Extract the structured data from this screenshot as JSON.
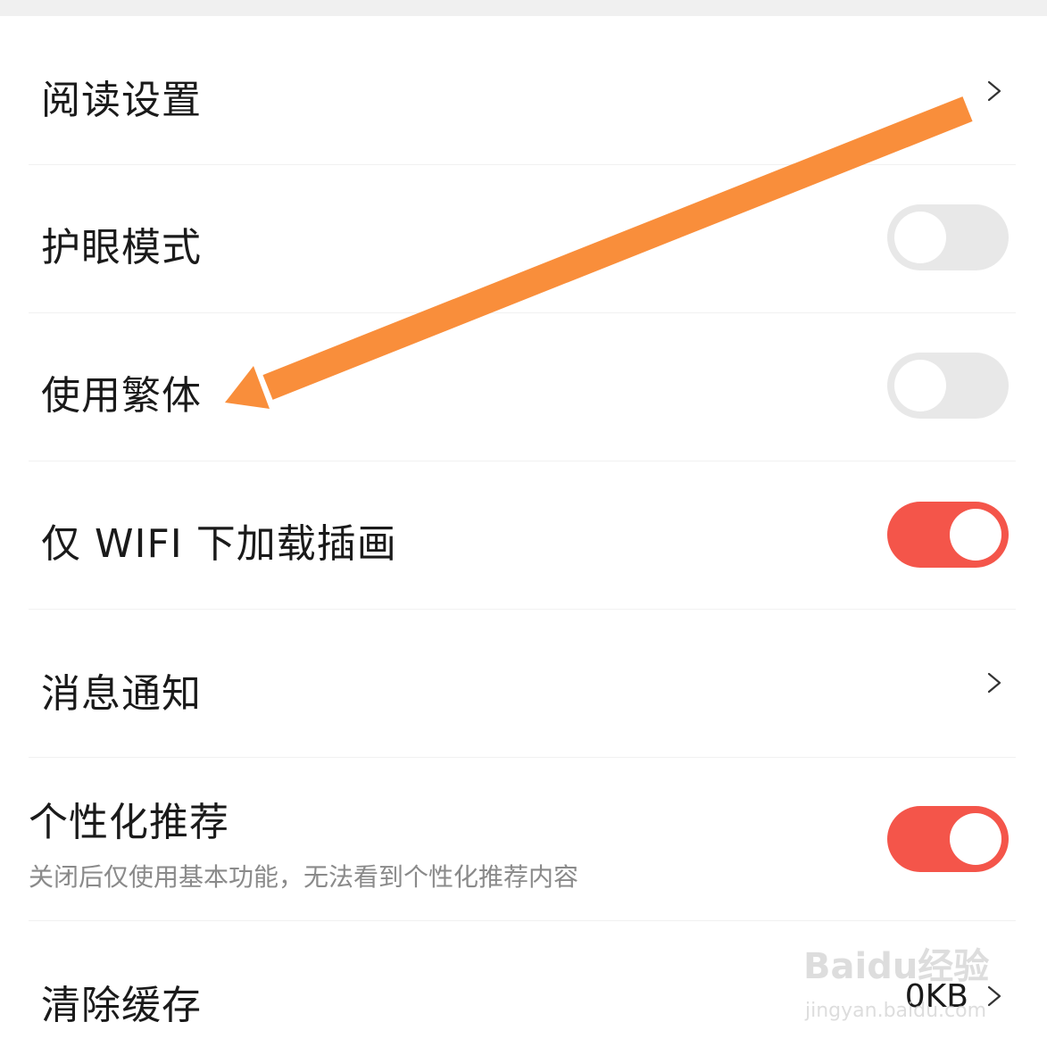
{
  "settings": {
    "reading": {
      "label": "阅读设置",
      "icon": "chevron-right-icon"
    },
    "eye_care": {
      "label": "护眼模式",
      "toggle_on": false
    },
    "traditional": {
      "label": "使用繁体",
      "toggle_on": false
    },
    "wifi_images": {
      "label": "仅 WIFI 下加载插画",
      "toggle_on": true
    },
    "notifications": {
      "label": "消息通知",
      "icon": "chevron-right-icon"
    },
    "personalized": {
      "label": "个性化推荐",
      "description": "关闭后仅使用基本功能，无法看到个性化推荐内容",
      "toggle_on": true
    },
    "clear_cache": {
      "label": "清除缓存",
      "value": "0KB",
      "icon": "chevron-right-icon"
    }
  },
  "colors": {
    "toggle_on": "#f4554a",
    "toggle_off": "#e8e8e8",
    "annotation_arrow": "#f98e3b"
  },
  "watermark": {
    "brand": "Baidu经验",
    "url": "jingyan.baidu.com"
  }
}
